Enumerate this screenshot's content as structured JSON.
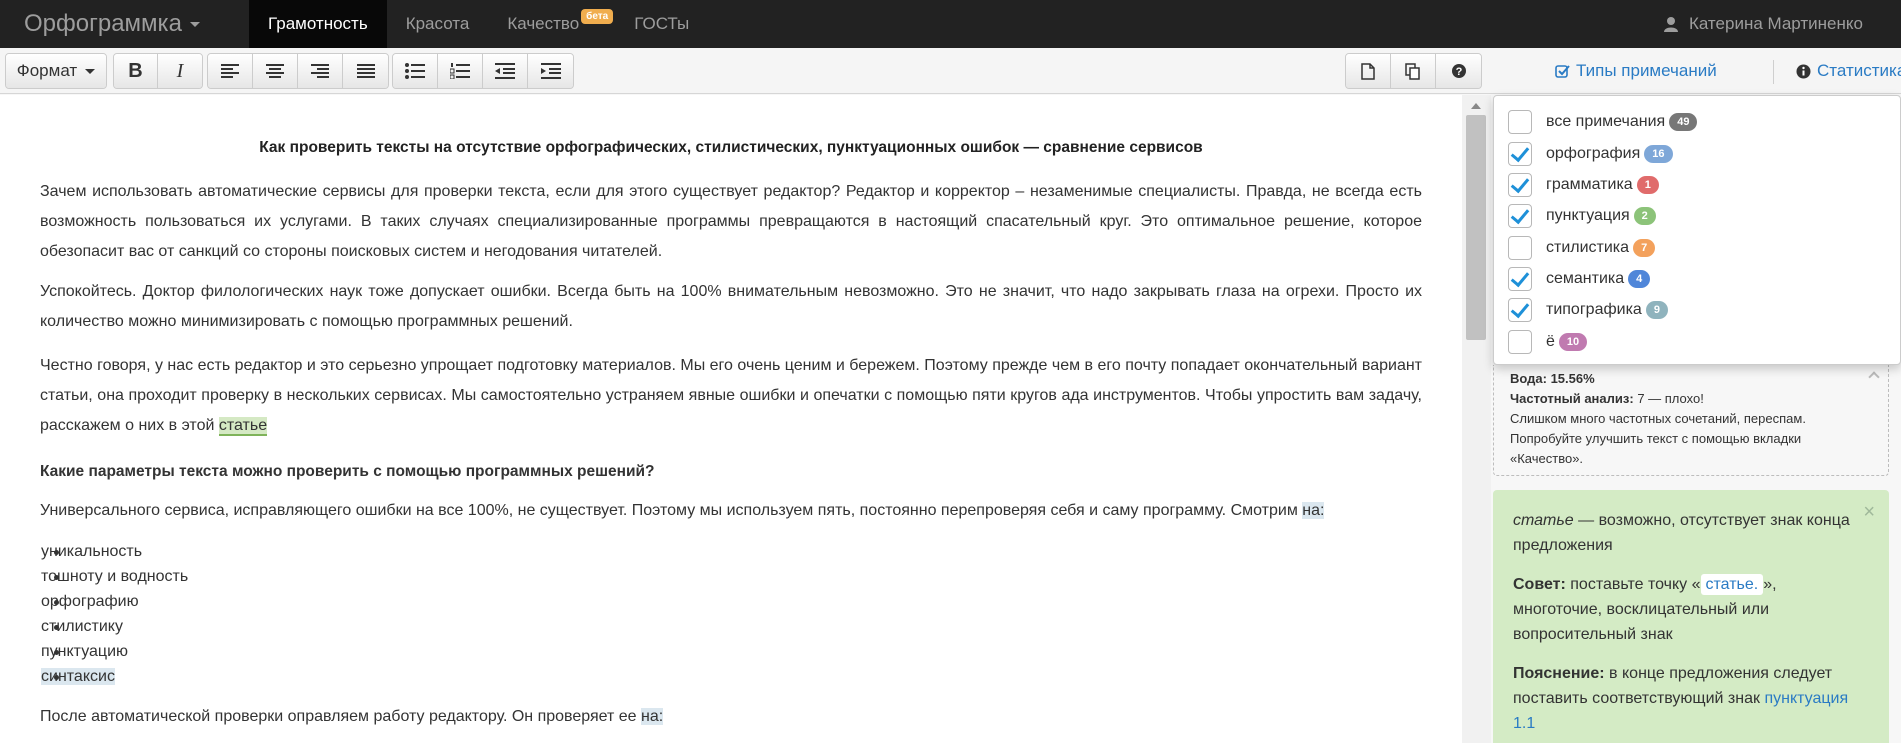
{
  "navbar": {
    "brand": "Орфограммка",
    "items": [
      {
        "label": "Грамотность",
        "active": true
      },
      {
        "label": "Красота"
      },
      {
        "label": "Качество",
        "badge": "бета"
      },
      {
        "label": "ГОСТы"
      }
    ],
    "user": "Катерина Мартиненко"
  },
  "toolbar": {
    "format_label": "Формат",
    "bold": "B",
    "italic": "I",
    "note_types_label": "Типы примечаний",
    "stats_label": "Статистика"
  },
  "editor": {
    "title": "Как проверить тексты на отсутствие орфографических, стилистических, пунктуационных ошибок — сравнение сервисов",
    "p1": "Зачем использовать автоматические сервисы для проверки текста, если для этого существует редактор? Редактор и корректор – незаменимые специалисты. Правда, не всегда есть возможность пользоваться их услугами. В таких случаях специализированные программы превращаются в настоящий спасательный круг. Это оптимальное решение, которое обезопасит вас от санкций со стороны поисковых систем и негодования читателей.",
    "p2": "Успокойтесь. Доктор филологических наук тоже допускает ошибки. Всегда быть на 100% внимательным невозможно. Это не значит, что надо закрывать глаза на огрехи. Просто их количество можно минимизировать с помощью программных решений.",
    "p3": "Честно говоря, у нас есть редактор и это серьезно упрощает подготовку материалов. Мы его очень ценим и бережем. Поэтому прежде чем в его почту попадает окончательный вариант статьи, она проходит проверку в нескольких сервисах. Мы самостоятельно устраняем явные ошибки и опечатки с помощью пяти кругов ада инструментов. Чтобы упростить вам задачу, расскажем о них в этой",
    "p3_flag": "статье",
    "heading2": "Какие параметры текста можно проверить с помощью программных решений?",
    "p4": "Универсального сервиса, исправляющего ошибки на все 100%, не существует. Поэтому мы используем пять, постоянно перепроверяя себя и саму программу. Смотрим",
    "p4_flag": "на:",
    "list": [
      "уникальность",
      "тошноту и водность",
      "орфографию",
      "стилистику",
      "пунктуацию",
      "синтаксис"
    ],
    "p5": "После автоматической проверки оправляем работу редактору. Он проверяет ее",
    "p5_flag": "на:"
  },
  "note_types": [
    {
      "label": "все примечания",
      "count": "49",
      "checked": false,
      "color": "#777777"
    },
    {
      "label": "орфография",
      "count": "16",
      "checked": true,
      "color": "#7ea7d8"
    },
    {
      "label": "грамматика",
      "count": "1",
      "checked": true,
      "color": "#e06b6b"
    },
    {
      "label": "пунктуация",
      "count": "2",
      "checked": true,
      "color": "#8cc379"
    },
    {
      "label": "стилистика",
      "count": "7",
      "checked": false,
      "color": "#f3a15c"
    },
    {
      "label": "семантика",
      "count": "4",
      "checked": true,
      "color": "#4f86d9"
    },
    {
      "label": "типографика",
      "count": "9",
      "checked": true,
      "color": "#8fb3bd"
    },
    {
      "label": "ё",
      "count": "10",
      "checked": false,
      "color": "#c07ab0"
    }
  ],
  "stats": {
    "water": "Вода: 15.56%",
    "freq_label": "Частотный анализ:",
    "freq_value": "7 — плохо!",
    "freq_text": "Слишком много частотных сочетаний, переспам. Попробуйте улучшить текст с помощью вкладки «Качество»."
  },
  "card": {
    "word": "статье",
    "message": "— возможно, отсутствует знак конца предложения",
    "tip_label": "Совет:",
    "tip_pre": "поставьте точку «",
    "tip_word": "статье.",
    "tip_post": "», многоточие, восклицательный или вопросительный знак",
    "explain_label": "Пояснение:",
    "explain_text": "в конце предложения следует поставить соответствующий знак",
    "explain_link": "пунктуация 1.1"
  }
}
